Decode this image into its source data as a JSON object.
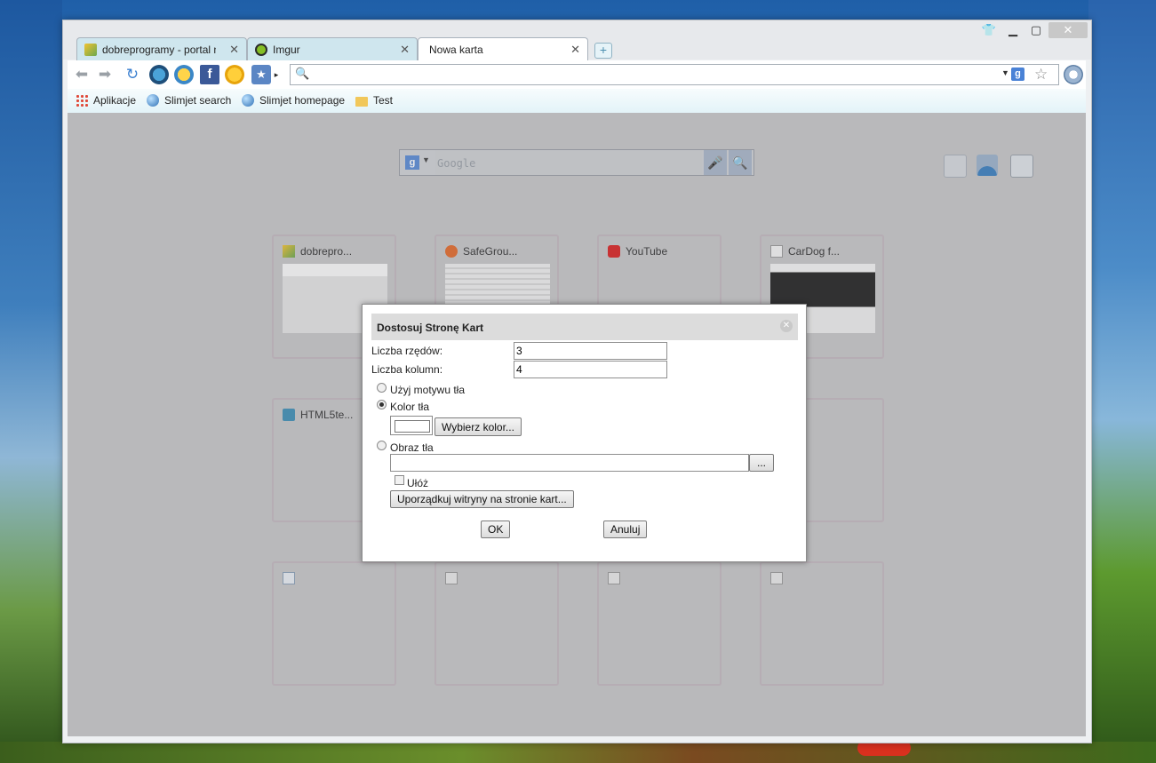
{
  "tabs": [
    {
      "label": "dobreprogramy - portal ni",
      "active": false
    },
    {
      "label": "Imgur",
      "active": false
    },
    {
      "label": "Nowa karta",
      "active": true
    }
  ],
  "toolbar": {
    "address_value": "",
    "icons": [
      "back-arrow-icon",
      "forward-arrow-icon",
      "reload-icon",
      "download-icon",
      "lightbulb-icon",
      "facebook-icon",
      "weather-icon",
      "bookmark-star-icon"
    ]
  },
  "bookmarks": [
    {
      "label": "Aplikacje",
      "icon": "apps-grid-icon"
    },
    {
      "label": "Slimjet search",
      "icon": "globe-icon"
    },
    {
      "label": "Slimjet homepage",
      "icon": "globe-icon"
    },
    {
      "label": "Test",
      "icon": "folder-icon"
    }
  ],
  "google_search": {
    "placeholder": "Google"
  },
  "tiles": [
    {
      "title": "dobrepro..."
    },
    {
      "title": "SafeGrou..."
    },
    {
      "title": "YouTube"
    },
    {
      "title": "CarDog f..."
    },
    {
      "title": "HTML5te..."
    },
    {
      "title": ""
    },
    {
      "title": ""
    },
    {
      "title": ""
    },
    {
      "title": ""
    },
    {
      "title": ""
    },
    {
      "title": ""
    },
    {
      "title": ""
    }
  ],
  "dialog": {
    "title": "Dostosuj Stronę Kart",
    "rows_label": "Liczba rzędów:",
    "rows_value": "3",
    "cols_label": "Liczba kolumn:",
    "cols_value": "4",
    "opt_theme": "Użyj motywu tła",
    "opt_color": "Kolor tła",
    "choose_color": "Wybierz kolor...",
    "opt_image": "Obraz tła",
    "browse": "...",
    "tile_label": "Ułóż",
    "arrange": "Uporządkuj witryny na stronie kart...",
    "ok": "OK",
    "cancel": "Anuluj"
  },
  "colors": {
    "accent": "#4a82d6",
    "tab_inactive": "#cfe6ee",
    "content_bg": "#c7c7c9"
  }
}
